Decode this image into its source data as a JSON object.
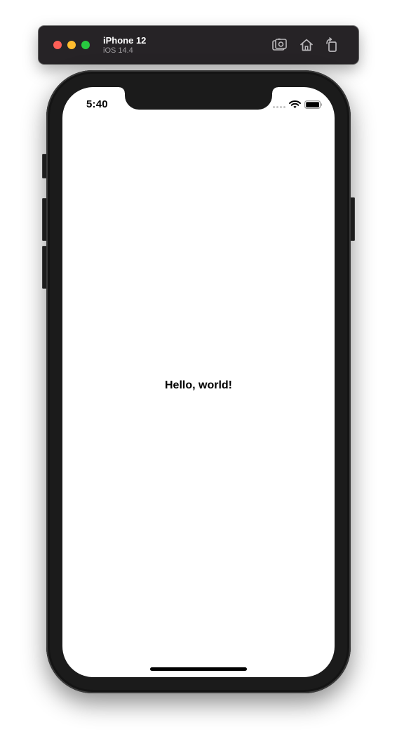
{
  "window": {
    "device_name": "iPhone 12",
    "os_version": "iOS 14.4",
    "toolbar_icons": [
      "screenshot-icon",
      "home-icon",
      "rotate-icon"
    ],
    "traffic_light_colors": {
      "close": "#fe5f57",
      "minimize": "#febc2e",
      "maximize": "#28c840"
    }
  },
  "status_bar": {
    "time": "5:40",
    "icons": [
      "cellular-signal-icon",
      "wifi-icon",
      "battery-icon"
    ]
  },
  "app": {
    "greeting": "Hello, world!"
  },
  "colors": {
    "toolbar_bg": "#262326",
    "device_frame": "#1b1b1b",
    "screen_bg": "#ffffff",
    "text": "#000000"
  }
}
